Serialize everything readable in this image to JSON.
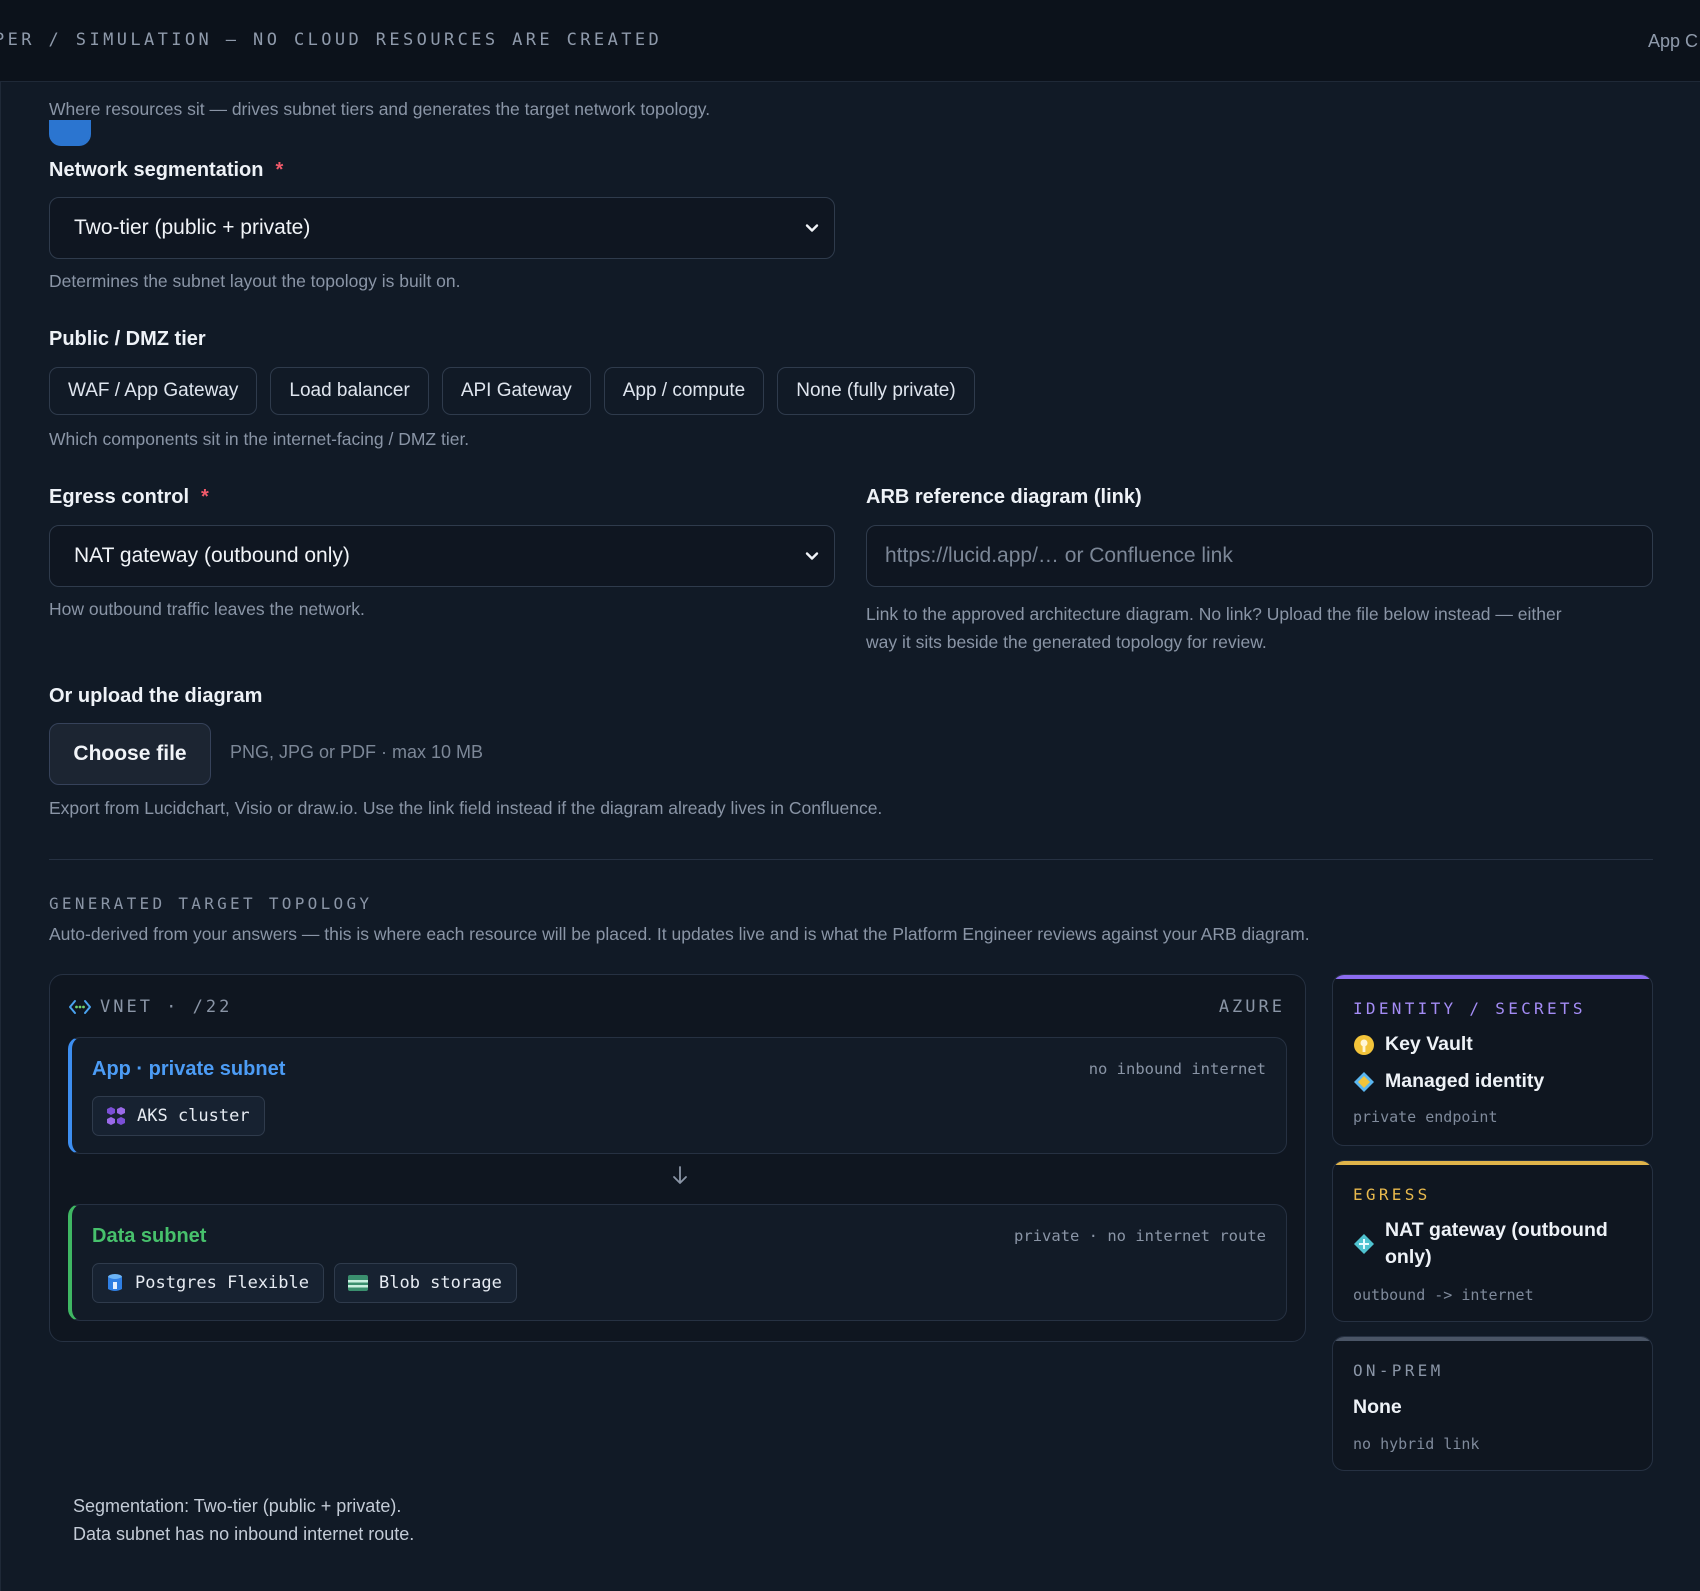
{
  "banner": {
    "text": "PER / SIMULATION — NO CLOUD RESOURCES ARE CREATED",
    "right_text": "App C"
  },
  "section": {
    "description": "Where resources sit — drives subnet tiers and generates the target network topology."
  },
  "network_segmentation": {
    "label": "Network segmentation",
    "required_mark": "*",
    "selected": "Two-tier (public + private)",
    "hint": "Determines the subnet layout the topology is built on."
  },
  "dmz": {
    "label": "Public / DMZ tier",
    "options": [
      "WAF / App Gateway",
      "Load balancer",
      "API Gateway",
      "App / compute",
      "None (fully private)"
    ],
    "hint": "Which components sit in the internet-facing / DMZ tier."
  },
  "egress_control": {
    "label": "Egress control",
    "required_mark": "*",
    "selected": "NAT gateway (outbound only)",
    "hint": "How outbound traffic leaves the network."
  },
  "arb_diagram": {
    "label": "ARB reference diagram (link)",
    "placeholder": "https://lucid.app/… or Confluence link",
    "hint_line1": "Link to the approved architecture diagram. No link? Upload the file below instead — either",
    "hint_line2": "way it sits beside the generated topology for review."
  },
  "upload": {
    "label": "Or upload the diagram",
    "button": "Choose file",
    "file_hint": "PNG, JPG or PDF · max 10 MB",
    "hint": "Export from Lucidchart, Visio or draw.io. Use the link field instead if the diagram already lives in Confluence."
  },
  "topology": {
    "kicker": "GENERATED TARGET TOPOLOGY",
    "description": "Auto-derived from your answers — this is where each resource will be placed. It updates live and is what the Platform Engineer reviews against your ARB diagram.",
    "vnet_label": "VNET · /22",
    "cloud": "AZURE",
    "app_subnet": {
      "title": "App · private subnet",
      "note": "no inbound internet",
      "resources": [
        "AKS cluster"
      ]
    },
    "data_subnet": {
      "title": "Data subnet",
      "note": "private · no internet route",
      "resources": [
        "Postgres Flexible",
        "Blob storage"
      ]
    },
    "identity": {
      "kicker": "IDENTITY / SECRETS",
      "items": [
        "Key Vault",
        "Managed identity"
      ],
      "foot": "private endpoint",
      "accent": "#8b6cf0"
    },
    "egress": {
      "kicker": "EGRESS",
      "item_line1": "NAT gateway (outbound",
      "item_line2": "only)",
      "foot": "outbound -> internet",
      "accent": "#e0b44a"
    },
    "onprem": {
      "kicker": "ON-PREM",
      "item": "None",
      "foot": "no hybrid link",
      "accent": "#4a5566"
    }
  },
  "summary": {
    "line1": "Segmentation: Two-tier (public + private).",
    "line2": "Data subnet has no inbound internet route."
  }
}
